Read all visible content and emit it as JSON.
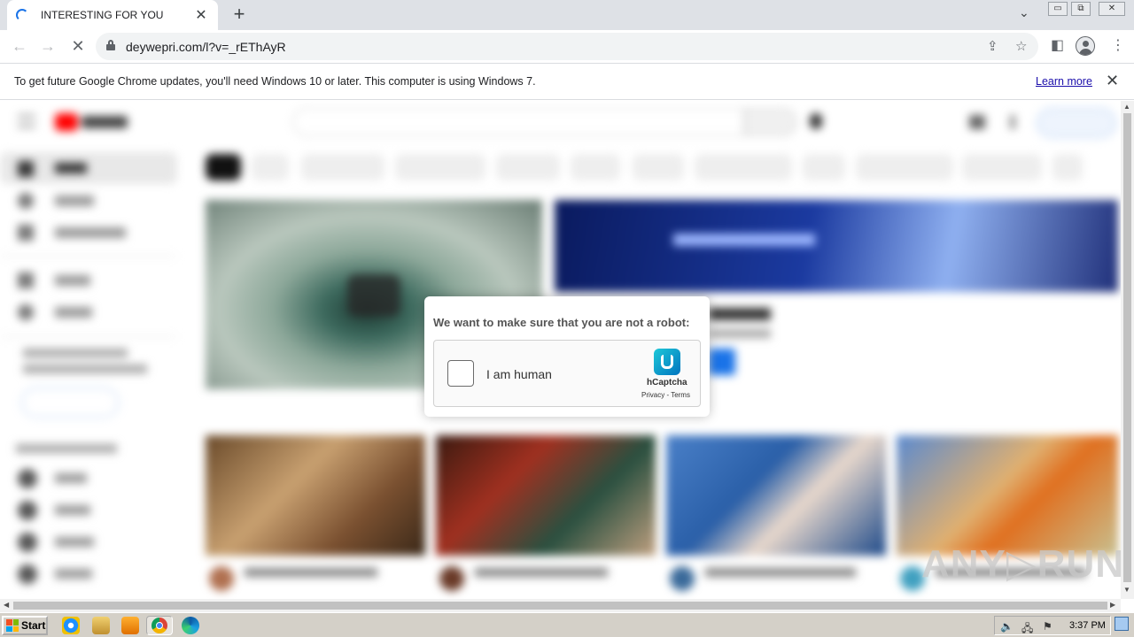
{
  "browser": {
    "tab": {
      "title": "INTERESTING FOR YOU",
      "close": "✕"
    },
    "new_tab": "+",
    "tab_search": "⌄",
    "window_controls": [
      "▭",
      "⧉",
      "✕"
    ],
    "nav": {
      "back": "←",
      "forward": "→",
      "reload": "✕"
    },
    "url": "deywepri.com/l?v=_rEThAyR",
    "omnibox_icons": [
      "share-icon",
      "star-icon"
    ],
    "toolbar_icons": [
      "side-panel-icon",
      "profile-icon",
      "menu-icon"
    ],
    "share_glyph": "⇪",
    "star_glyph": "☆",
    "sidepanel_glyph": "◧",
    "menu_glyph": "⋮"
  },
  "infobar": {
    "message": "To get future Google Chrome updates, you'll need Windows 10 or later. This computer is using Windows 7.",
    "link": "Learn more",
    "close": "✕"
  },
  "captcha": {
    "question": "We want to make sure that you are not a robot:",
    "checkbox_label": "I am human",
    "brand": "hCaptcha",
    "links": "Privacy - Terms"
  },
  "watermark": "ANY▷RUN",
  "taskbar": {
    "start_label": "Start",
    "apps": [
      "ie-icon",
      "explorer-icon",
      "media-player-icon",
      "chrome-icon",
      "edge-icon"
    ],
    "time": "3:37 PM",
    "tray_icons": [
      "volume-icon",
      "network-icon",
      "flag-icon"
    ]
  },
  "colors": {
    "accent": "#1a73e8",
    "link": "#1a0dab",
    "youtube_red": "#ff0000"
  }
}
